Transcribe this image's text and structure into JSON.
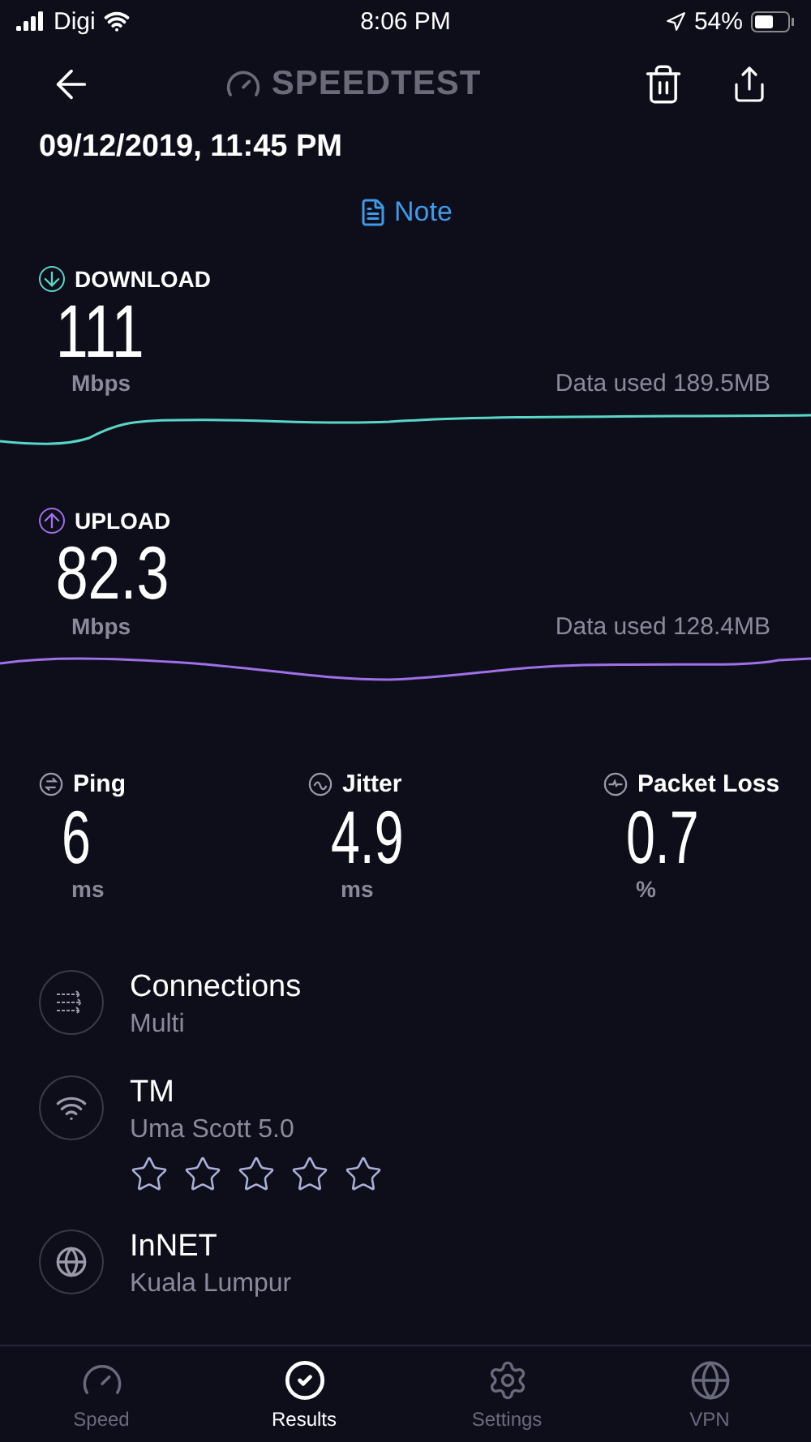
{
  "status_bar": {
    "carrier": "Digi",
    "time": "8:06 PM",
    "battery": "54%"
  },
  "header": {
    "logo": "SPEEDTEST"
  },
  "result": {
    "date": "09/12/2019, 11:45 PM",
    "note": "Note"
  },
  "speeds": [
    {
      "kind": "download",
      "label": "DOWNLOAD",
      "value": "111",
      "unit": "Mbps",
      "data_used": "Data used 189.5MB",
      "color": "#5ad6c8"
    },
    {
      "kind": "upload",
      "label": "UPLOAD",
      "value": "82.3",
      "unit": "Mbps",
      "data_used": "Data used 128.4MB",
      "color": "#a070e8"
    }
  ],
  "metrics": [
    {
      "kind": "ping",
      "label": "Ping",
      "value": "6",
      "unit": "ms"
    },
    {
      "kind": "jitter",
      "label": "Jitter",
      "value": "4.9",
      "unit": "ms"
    },
    {
      "kind": "loss",
      "label": "Packet Loss",
      "value": "0.7",
      "unit": "%"
    }
  ],
  "details": [
    {
      "kind": "connections",
      "title": "Connections",
      "subtitle": "Multi"
    },
    {
      "kind": "provider",
      "title": "TM",
      "subtitle": "Uma Scott 5.0",
      "stars": 0
    },
    {
      "kind": "server",
      "title": "InNET",
      "subtitle": "Kuala Lumpur"
    }
  ],
  "tabs": [
    {
      "kind": "speed",
      "label": "Speed",
      "selected": false
    },
    {
      "kind": "results",
      "label": "Results",
      "selected": true
    },
    {
      "kind": "settings",
      "label": "Settings",
      "selected": false
    },
    {
      "kind": "vpn",
      "label": "VPN",
      "selected": false
    }
  ]
}
